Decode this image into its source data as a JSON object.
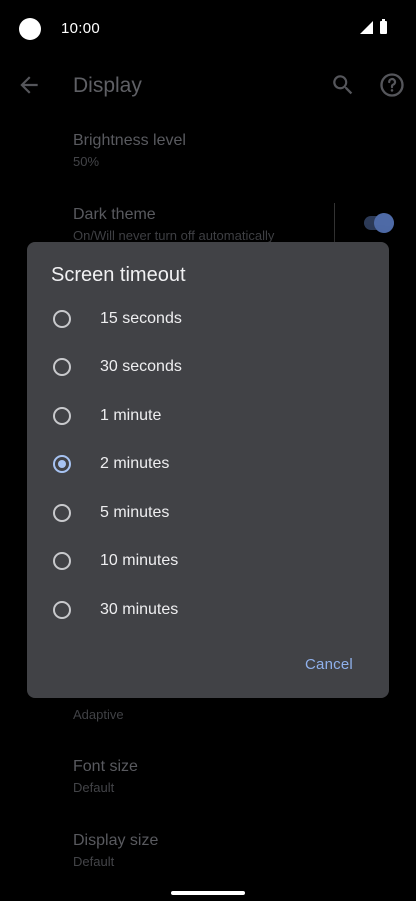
{
  "status_bar": {
    "time": "10:00"
  },
  "app_bar": {
    "title": "Display"
  },
  "settings": {
    "brightness": {
      "title": "Brightness level",
      "summary": "50%"
    },
    "dark_theme": {
      "title": "Dark theme",
      "summary": "On/Will never turn off automatically",
      "enabled": true
    },
    "adaptive": {
      "summary": "Adaptive"
    },
    "font_size": {
      "title": "Font size",
      "summary": "Default"
    },
    "display_size": {
      "title": "Display size",
      "summary": "Default"
    }
  },
  "dialog": {
    "title": "Screen timeout",
    "options": [
      {
        "label": "15 seconds",
        "selected": false
      },
      {
        "label": "30 seconds",
        "selected": false
      },
      {
        "label": "1 minute",
        "selected": false
      },
      {
        "label": "2 minutes",
        "selected": true
      },
      {
        "label": "5 minutes",
        "selected": false
      },
      {
        "label": "10 minutes",
        "selected": false
      },
      {
        "label": "30 minutes",
        "selected": false
      }
    ],
    "cancel_label": "Cancel"
  },
  "colors": {
    "dialog_bg": "#414246",
    "accent": "#a7c3f2",
    "cancel": "#8fb0eb"
  },
  "icons": [
    "back-arrow-icon",
    "search-icon",
    "help-icon",
    "radio-button-icon"
  ]
}
